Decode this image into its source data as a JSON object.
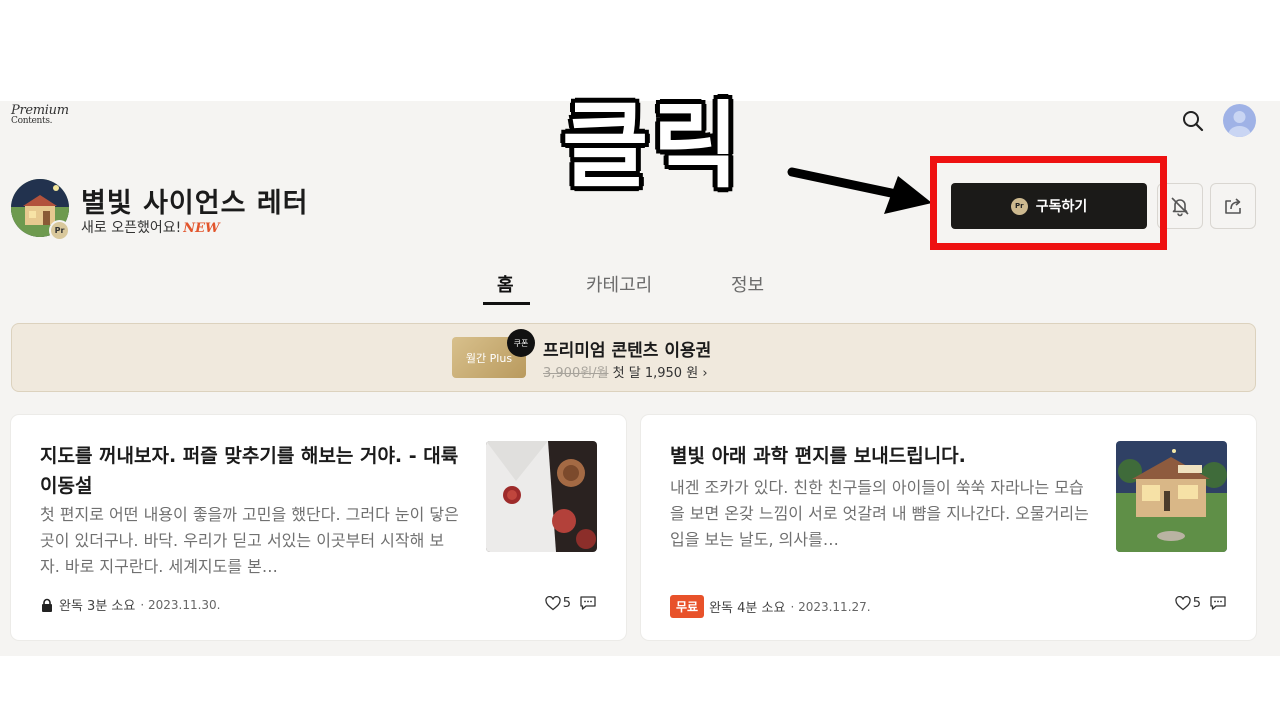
{
  "header": {
    "logo_line1": "Premium",
    "logo_line2": "Contents.",
    "search_icon": "search-icon",
    "avatar_icon": "user-avatar-icon"
  },
  "channel": {
    "title": "별빛 사이언스 레터",
    "subtitle": "새로 오픈했어요!",
    "new_badge": "NEW",
    "thumb_badge": "Pr",
    "subscribe_label": "구독하기",
    "subscribe_icon_text": "Pr",
    "bell_icon": "bell-off-icon",
    "share_icon": "share-icon"
  },
  "tabs": [
    {
      "label": "홈",
      "active": true
    },
    {
      "label": "카테고리",
      "active": false
    },
    {
      "label": "정보",
      "active": false
    }
  ],
  "coupon": {
    "card_label": "월간 Plus",
    "tag": "쿠폰",
    "title": "프리미엄 콘텐츠 이용권",
    "old_price": "3,900원/월",
    "new_price": "첫 달 1,950 원",
    "chevron": "›"
  },
  "posts": [
    {
      "title": "지도를 꺼내보자. 퍼즐 맞추기를 해보는 거야. - 대륙이동설",
      "excerpt": "첫 편지로 어떤 내용이 좋을까 고민을 했단다. 그러다 눈이 닿은 곳이 있더구나. 바닥. 우리가 딛고 서있는 이곳부터 시작해 보자. 바로 지구란다. 세계지도를 본…",
      "read_status": "완독 3분 소요",
      "date": "· 2023.11.30.",
      "likes": "5",
      "locked": true
    },
    {
      "title": "별빛 아래 과학 편지를 보내드립니다.",
      "excerpt": "내겐 조카가 있다. 친한 친구들의 아이들이 쑥쑥 자라나는 모습을 보면 온갖 느낌이 서로 엇갈려 내 뺨을 지나간다. 오물거리는 입을 보는 날도, 의사를…",
      "free_label": "무료",
      "read_status": "완독 4분 소요",
      "date": "· 2023.11.27.",
      "likes": "5",
      "locked": false
    }
  ],
  "annotation": {
    "text": "클릭",
    "highlight_color": "#ee1111"
  },
  "colors": {
    "background": "#f5f4f2",
    "subscribe_button": "#1b1a18",
    "accent_new": "#e2552c",
    "free_badge": "#e8522a",
    "coupon_bg": "#f0e9dd"
  }
}
